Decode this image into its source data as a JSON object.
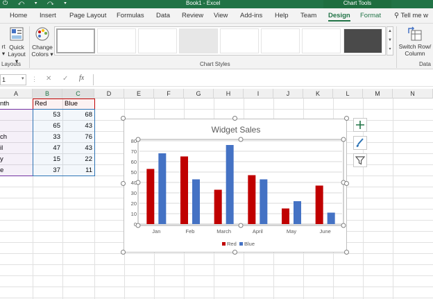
{
  "titlebar": {
    "quick_access": "⏻ ↶ ▾ ↷ ▾",
    "title": "Book1 - Excel",
    "context": "Chart Tools"
  },
  "tabs": [
    {
      "label": "Home"
    },
    {
      "label": "Insert"
    },
    {
      "label": "Page Layout"
    },
    {
      "label": "Formulas"
    },
    {
      "label": "Data"
    },
    {
      "label": "Review"
    },
    {
      "label": "View"
    },
    {
      "label": "Add-ins"
    },
    {
      "label": "Help"
    },
    {
      "label": "Team"
    },
    {
      "label": "Design"
    },
    {
      "label": "Format"
    }
  ],
  "tell_me": "Tell me w",
  "ribbon": {
    "add_element": "rt\n▾",
    "quick_layout": "Quick\nLayout ▾",
    "layouts_group": "Layouts",
    "change_colors": "Change\nColors ▾",
    "chart_styles_group": "Chart Styles",
    "switch_row_col": "Switch Row/\nColumn",
    "data_group": "Data"
  },
  "formula_bar": {
    "name_box": "1",
    "fx": "fx",
    "cancel": "✕",
    "enter": "✓"
  },
  "columns": [
    "A",
    "B",
    "C",
    "D",
    "E",
    "F",
    "G",
    "H",
    "I",
    "J",
    "K",
    "L",
    "M",
    "N"
  ],
  "sheet": {
    "headers": {
      "a": "nth",
      "b": "Red",
      "c": "Blue"
    },
    "rows": [
      {
        "a": "",
        "b": "53",
        "c": "68"
      },
      {
        "a": "",
        "b": "65",
        "c": "43"
      },
      {
        "a": "ch",
        "b": "33",
        "c": "76"
      },
      {
        "a": "il",
        "b": "47",
        "c": "43"
      },
      {
        "a": "y",
        "b": "15",
        "c": "22"
      },
      {
        "a": "e",
        "b": "37",
        "c": "11"
      }
    ]
  },
  "chart_data": {
    "type": "bar",
    "title": "Widget Sales",
    "categories": [
      "Jan",
      "Feb",
      "March",
      "April",
      "May",
      "June"
    ],
    "series": [
      {
        "name": "Red",
        "values": [
          53,
          65,
          33,
          47,
          15,
          37
        ],
        "color": "#c00000"
      },
      {
        "name": "Blue",
        "values": [
          68,
          43,
          76,
          43,
          22,
          11
        ],
        "color": "#4472c4"
      }
    ],
    "ylim": [
      0,
      80
    ],
    "yticks": [
      "0",
      "10",
      "20",
      "30",
      "40",
      "50",
      "60",
      "70",
      "80"
    ],
    "grid": true,
    "legend": "bottom"
  },
  "colors": {
    "excel_green": "#217346",
    "red": "#c00000",
    "blue": "#4472c4",
    "sel_purple": "#7030a0",
    "sel_blue": "#2e74b5"
  }
}
